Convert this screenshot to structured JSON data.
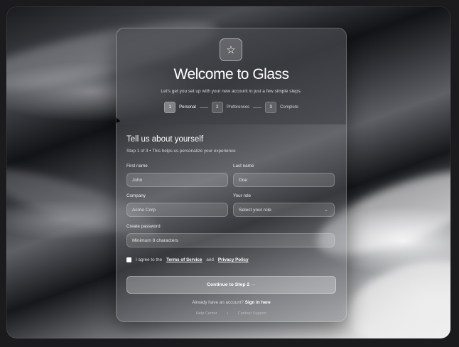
{
  "brand": {
    "icon": "star-icon",
    "accent": "#ffffff"
  },
  "header": {
    "title": "Welcome to Glass",
    "subtitle": "Let's get you set up with your new account in just a few simple steps."
  },
  "steps": [
    {
      "num": "1",
      "label": "Personal"
    },
    {
      "num": "2",
      "label": "Preferences"
    },
    {
      "num": "3",
      "label": "Complete"
    }
  ],
  "form": {
    "title": "Tell us about yourself",
    "subtitle": "Step 1 of 3 • This helps us personalize your experience",
    "first_name": {
      "label": "First name",
      "value": "John"
    },
    "last_name": {
      "label": "Last name",
      "value": "Doe"
    },
    "company": {
      "label": "Company",
      "value": "Acme Corp"
    },
    "role": {
      "label": "Your role",
      "value": "Select your role"
    },
    "password": {
      "label": "Create password",
      "placeholder": "Minimum 8 characters"
    },
    "agree": {
      "prefix": "I agree to the",
      "terms": "Terms of Service",
      "and": "and",
      "privacy": "Privacy Policy"
    },
    "continue_label": "Continue to Step 2 →"
  },
  "footer": {
    "signin_prefix": "Already have an account?",
    "signin_link": "Sign in here",
    "help": "Help Center",
    "separator": "•",
    "contact": "Contact Support"
  }
}
